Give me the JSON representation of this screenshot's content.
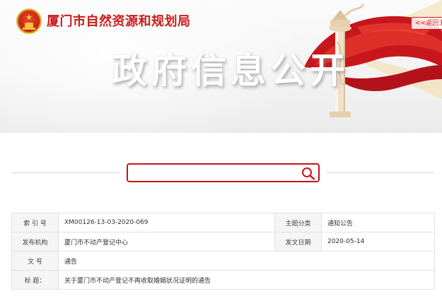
{
  "header": {
    "org_name": "厦门市自然资源和规划局",
    "back_link": "<<返回主站",
    "hero_title": "政府信息公开"
  },
  "search": {
    "placeholder": "",
    "value": ""
  },
  "info_table": {
    "index_label": "索 引 号",
    "index_value": "XM00126-13-03-2020-069",
    "category_label": "主题分类",
    "category_value": "通知公告",
    "publisher_label": "发布机构",
    "publisher_value": "厦门市不动产登记中心",
    "date_label": "发文日期",
    "date_value": "2020-05-14",
    "doc_no_label": "文 号",
    "doc_no_value": "通告",
    "title_label": "标    题：",
    "title_value": "关于厦门市不动产登记不再收取婚姻状况证明的通告"
  },
  "colors": {
    "brand_red": "#c91b1b",
    "search_border": "#c4161c",
    "label_bg": "#f5f5f5",
    "border": "#e2e2e2"
  },
  "icons": {
    "emblem": "national-emblem-icon",
    "search": "search-icon",
    "huabiao": "huabiao-pillar-icon",
    "flag": "red-ribbon-flag-icon"
  }
}
